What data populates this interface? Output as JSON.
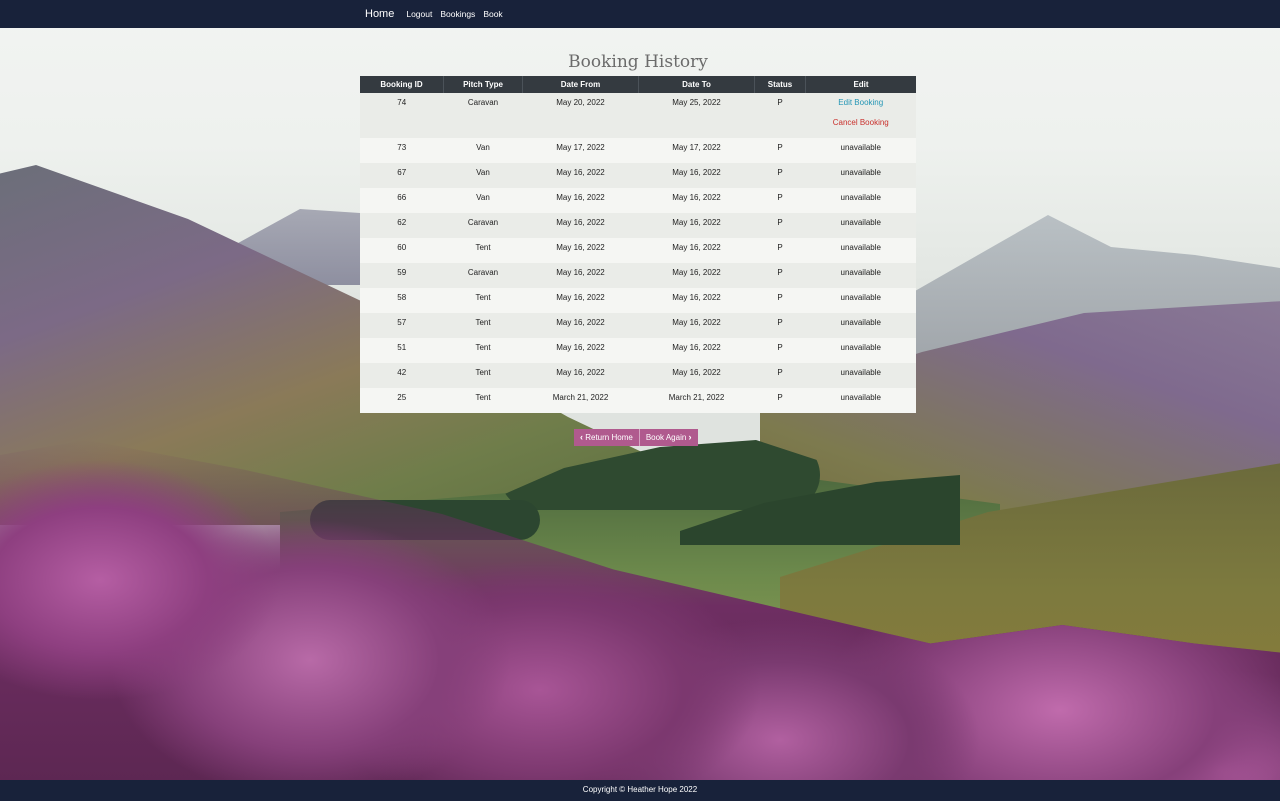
{
  "nav": {
    "brand": "Home",
    "links": [
      "Logout",
      "Bookings",
      "Book"
    ]
  },
  "page": {
    "title": "Booking History"
  },
  "table": {
    "headers": [
      "Booking ID",
      "Pitch Type",
      "Date From",
      "Date To",
      "Status",
      "Edit"
    ],
    "rows": [
      {
        "id": "74",
        "pitch": "Caravan",
        "from": "May 20, 2022",
        "to": "May 25, 2022",
        "status": "P",
        "edit": "Edit Booking",
        "cancel": "Cancel Booking"
      },
      {
        "id": "73",
        "pitch": "Van",
        "from": "May 17, 2022",
        "to": "May 17, 2022",
        "status": "P",
        "edit": "unavailable"
      },
      {
        "id": "67",
        "pitch": "Van",
        "from": "May 16, 2022",
        "to": "May 16, 2022",
        "status": "P",
        "edit": "unavailable"
      },
      {
        "id": "66",
        "pitch": "Van",
        "from": "May 16, 2022",
        "to": "May 16, 2022",
        "status": "P",
        "edit": "unavailable"
      },
      {
        "id": "62",
        "pitch": "Caravan",
        "from": "May 16, 2022",
        "to": "May 16, 2022",
        "status": "P",
        "edit": "unavailable"
      },
      {
        "id": "60",
        "pitch": "Tent",
        "from": "May 16, 2022",
        "to": "May 16, 2022",
        "status": "P",
        "edit": "unavailable"
      },
      {
        "id": "59",
        "pitch": "Caravan",
        "from": "May 16, 2022",
        "to": "May 16, 2022",
        "status": "P",
        "edit": "unavailable"
      },
      {
        "id": "58",
        "pitch": "Tent",
        "from": "May 16, 2022",
        "to": "May 16, 2022",
        "status": "P",
        "edit": "unavailable"
      },
      {
        "id": "57",
        "pitch": "Tent",
        "from": "May 16, 2022",
        "to": "May 16, 2022",
        "status": "P",
        "edit": "unavailable"
      },
      {
        "id": "51",
        "pitch": "Tent",
        "from": "May 16, 2022",
        "to": "May 16, 2022",
        "status": "P",
        "edit": "unavailable"
      },
      {
        "id": "42",
        "pitch": "Tent",
        "from": "May 16, 2022",
        "to": "May 16, 2022",
        "status": "P",
        "edit": "unavailable"
      },
      {
        "id": "25",
        "pitch": "Tent",
        "from": "March 21, 2022",
        "to": "March 21, 2022",
        "status": "P",
        "edit": "unavailable"
      }
    ]
  },
  "buttons": {
    "return_home": "Return Home",
    "book_again": "Book Again"
  },
  "footer": {
    "text": "Copyright © Heather Hope 2022"
  },
  "colors": {
    "navbar": "#18223a",
    "table_header": "#343a40",
    "button": "#b05a8e",
    "edit_link": "#2496b5",
    "cancel_link": "#c9302c"
  },
  "icons": {
    "return_home": "chevron-left-icon",
    "book_again": "chevron-right-icon"
  }
}
